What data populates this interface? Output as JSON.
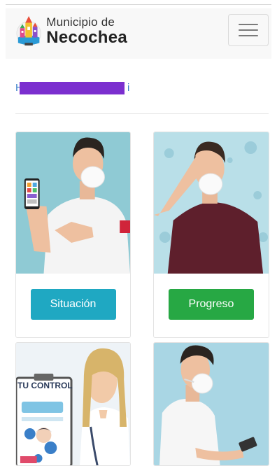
{
  "header": {
    "logo": {
      "line1": "Municipio de",
      "line2": "Necochea"
    },
    "menu_icon": "hamburger-menu-icon"
  },
  "link": {
    "visible_text": "H",
    "visible_tail": "i",
    "color": "#3a7fc8",
    "redaction_color": "#7b2fcf"
  },
  "cards": [
    {
      "button_label": "Situación",
      "button_color": "#1fa8c2"
    },
    {
      "button_label": "Progreso",
      "button_color": "#27a844"
    },
    {
      "image_caption": "TU CONTROL"
    },
    {}
  ],
  "colors": {
    "teal_background": "#8fcad4",
    "light_blue_background": "#b9dfe8"
  }
}
